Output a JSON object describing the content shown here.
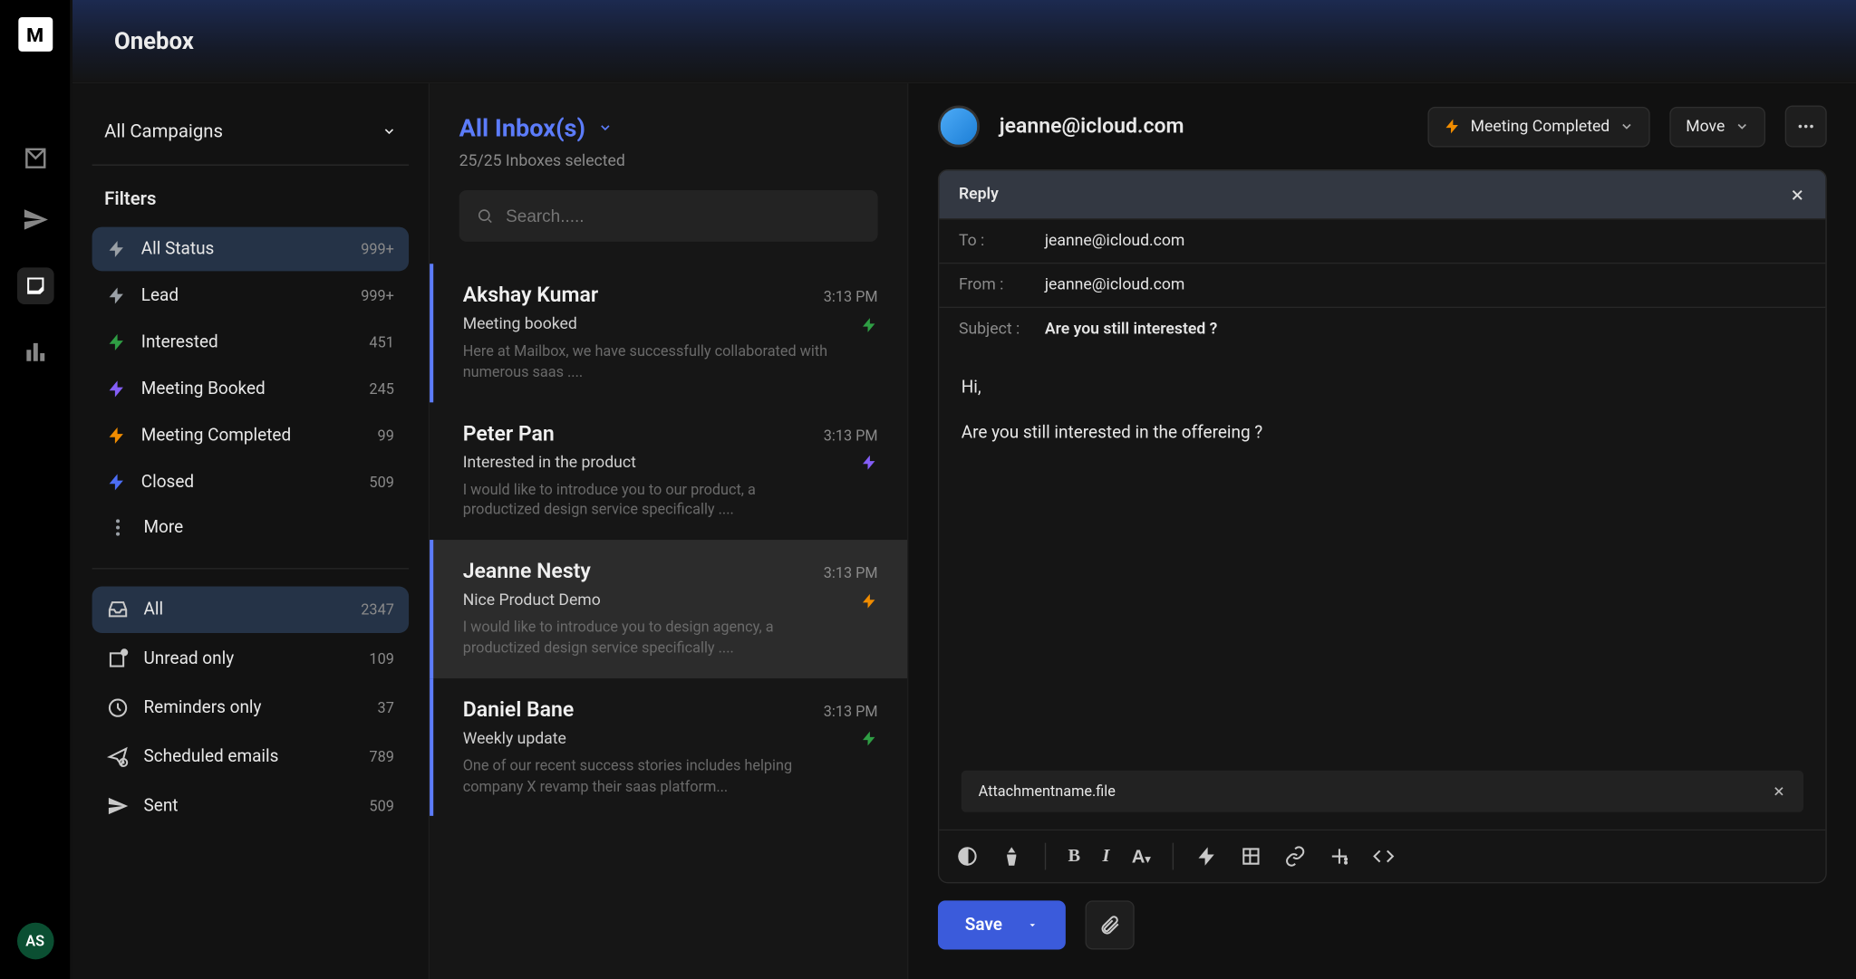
{
  "app_title": "Onebox",
  "rail": {
    "logo_letter": "M",
    "avatar_initials": "AS"
  },
  "sidebar": {
    "campaigns_label": "All Campaigns",
    "filters_heading": "Filters",
    "status_filters": [
      {
        "id": "all-status",
        "label": "All Status",
        "count": "999+",
        "color": "#9aa0a6"
      },
      {
        "id": "lead",
        "label": "Lead",
        "count": "999+",
        "color": "#9aa0a6"
      },
      {
        "id": "interested",
        "label": "Interested",
        "count": "451",
        "color": "#2f9e44"
      },
      {
        "id": "meeting-booked",
        "label": "Meeting Booked",
        "count": "245",
        "color": "#845ef7"
      },
      {
        "id": "meeting-completed",
        "label": "Meeting Completed",
        "count": "99",
        "color": "#f08c00"
      },
      {
        "id": "closed",
        "label": "Closed",
        "count": "509",
        "color": "#4c6ef5"
      }
    ],
    "more_label": "More",
    "folders": [
      {
        "id": "all",
        "label": "All",
        "count": "2347"
      },
      {
        "id": "unread",
        "label": "Unread only",
        "count": "109"
      },
      {
        "id": "reminders",
        "label": "Reminders only",
        "count": "37"
      },
      {
        "id": "scheduled",
        "label": "Scheduled emails",
        "count": "789"
      },
      {
        "id": "sent",
        "label": "Sent",
        "count": "509"
      }
    ]
  },
  "list": {
    "inbox_label": "All Inbox(s)",
    "inbox_subtitle": "25/25 Inboxes selected",
    "search_placeholder": "Search.....",
    "emails": [
      {
        "name": "Akshay Kumar",
        "time": "3:13 PM",
        "subject": "Meeting booked",
        "snippet": "Here at Mailbox, we have successfully collaborated with numerous saas ....",
        "bolt": "#2f9e44",
        "unread": true,
        "selected": false
      },
      {
        "name": "Peter Pan",
        "time": "3:13 PM",
        "subject": "Interested in the product",
        "snippet": "I would like to introduce you to our product, a productized design service specifically ....",
        "bolt": "#845ef7",
        "unread": false,
        "selected": false
      },
      {
        "name": "Jeanne Nesty",
        "time": "3:13 PM",
        "subject": "Nice Product Demo",
        "snippet": "I would like to introduce you to design agency, a productized design service specifically ....",
        "bolt": "#f08c00",
        "unread": true,
        "selected": true
      },
      {
        "name": "Daniel Bane",
        "time": "3:13 PM",
        "subject": "Weekly update",
        "snippet": "One of our recent success stories includes helping company X revamp their saas platform...",
        "bolt": "#2f9e44",
        "unread": true,
        "selected": false
      }
    ]
  },
  "reader": {
    "address": "jeanne@icloud.com",
    "status_label": "Meeting Completed",
    "status_color": "#f08c00",
    "move_label": "Move",
    "reply_label": "Reply",
    "to_label": "To :",
    "to_value": "jeanne@icloud.com",
    "from_label": "From :",
    "from_value": "jeanne@icloud.com",
    "subject_label": "Subject :",
    "subject_value": "Are you still interested ?",
    "body_line1": "Hi,",
    "body_line2": "Are you still interested in the offereing ?",
    "attachment_name": "Attachmentname.file",
    "save_label": "Save"
  }
}
